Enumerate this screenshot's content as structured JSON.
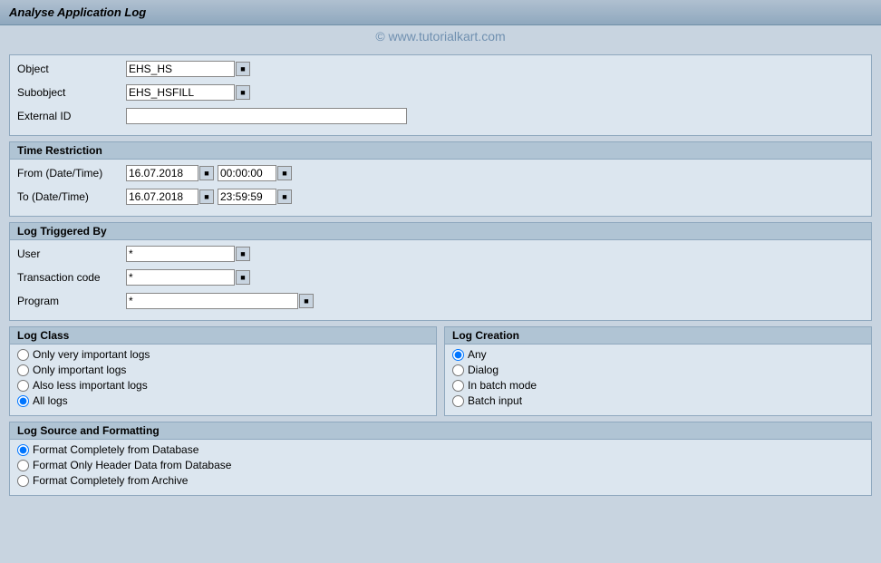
{
  "title": "Analyse Application Log",
  "watermark": "© www.tutorialkart.com",
  "fields": {
    "object_label": "Object",
    "object_value": "EHS_HS",
    "subobject_label": "Subobject",
    "subobject_value": "EHS_HSFILL",
    "external_id_label": "External ID",
    "external_id_value": ""
  },
  "time_restriction": {
    "title": "Time Restriction",
    "from_label": "From (Date/Time)",
    "from_date": "16.07.2018",
    "from_time": "00:00:00",
    "to_label": "To (Date/Time)",
    "to_date": "16.07.2018",
    "to_time": "23:59:59"
  },
  "log_triggered_by": {
    "title": "Log Triggered By",
    "user_label": "User",
    "user_value": "*",
    "transaction_label": "Transaction code",
    "transaction_value": "*",
    "program_label": "Program",
    "program_value": "*"
  },
  "log_class": {
    "title": "Log Class",
    "options": [
      {
        "id": "lc1",
        "label": "Only very important logs",
        "checked": false
      },
      {
        "id": "lc2",
        "label": "Only important logs",
        "checked": false
      },
      {
        "id": "lc3",
        "label": "Also less important logs",
        "checked": false
      },
      {
        "id": "lc4",
        "label": "All logs",
        "checked": true
      }
    ]
  },
  "log_creation": {
    "title": "Log Creation",
    "options": [
      {
        "id": "lgc1",
        "label": "Any",
        "checked": true
      },
      {
        "id": "lgc2",
        "label": "Dialog",
        "checked": false
      },
      {
        "id": "lgc3",
        "label": "In batch mode",
        "checked": false
      },
      {
        "id": "lgc4",
        "label": "Batch input",
        "checked": false
      }
    ]
  },
  "log_source": {
    "title": "Log Source and Formatting",
    "options": [
      {
        "id": "ls1",
        "label": "Format Completely from Database",
        "checked": true
      },
      {
        "id": "ls2",
        "label": "Format Only Header Data from Database",
        "checked": false
      },
      {
        "id": "ls3",
        "label": "Format Completely from Archive",
        "checked": false
      }
    ]
  }
}
